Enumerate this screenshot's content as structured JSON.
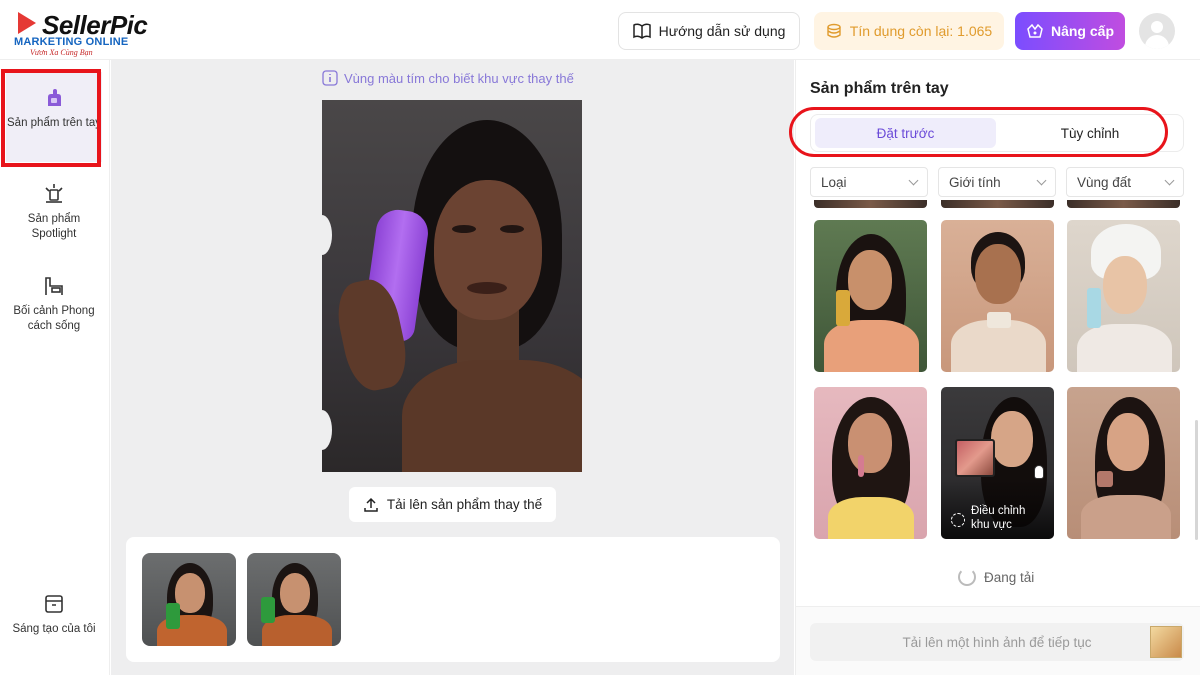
{
  "header": {
    "logo_text": "SellerPic",
    "logo_sub1": "MARKETING ONLINE",
    "logo_sub2": "Vươn Xa Cùng Bạn",
    "guide_label": "Hướng dẫn sử dụng",
    "credit_label": "Tín dụng còn lại: 1.065",
    "upgrade_label": "Nâng cấp"
  },
  "sidebar": {
    "items": [
      {
        "label": "Sản phẩm trên tay",
        "icon": "hand-product-icon"
      },
      {
        "label": "Sản phẩm Spotlight",
        "icon": "spotlight-icon"
      },
      {
        "label": "Bối cảnh Phong cách sống",
        "icon": "lifestyle-icon"
      },
      {
        "label": "Sáng tạo của tôi",
        "icon": "archive-icon"
      }
    ]
  },
  "canvas": {
    "notice": "Vùng màu tím cho biết khu vực thay thế",
    "upload_label": "Tải lên sản phẩm thay thế"
  },
  "panel": {
    "title": "Sản phẩm trên tay",
    "tabs": [
      "Đặt trước",
      "Tùy chỉnh"
    ],
    "filters": [
      "Loại",
      "Giới tính",
      "Vùng đất"
    ],
    "adjust_label": "Điều chỉnh khu vực",
    "loading": "Đang tải",
    "continue_label": "Tải lên một hình ảnh để tiếp tục"
  },
  "colors": {
    "accent": "#7b4dff",
    "highlight_red": "#e8141b",
    "credit_text": "#e09b2d"
  }
}
